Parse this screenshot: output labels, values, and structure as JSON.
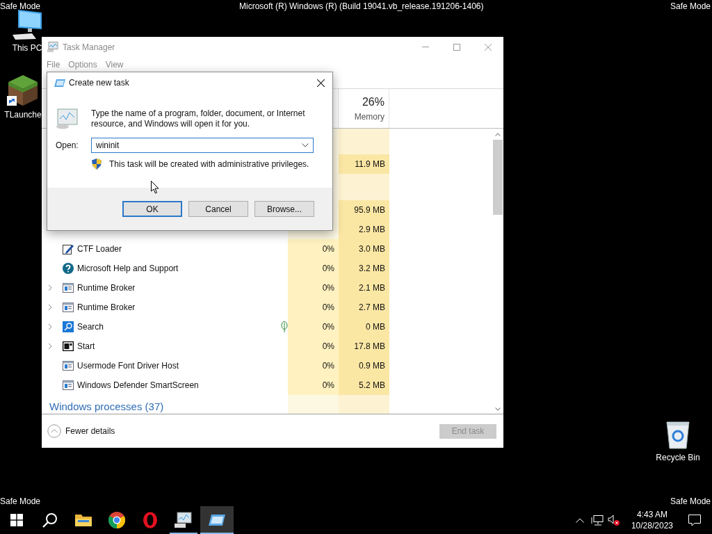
{
  "desktop": {
    "top_left": "Safe Mode",
    "top_center": "Microsoft (R) Windows (R) (Build 19041.vb_release.191206-1406)",
    "top_right": "Safe Mode",
    "bottom_left": "Safe Mode",
    "bottom_right": "Safe Mode",
    "icons": [
      {
        "kind": "computer",
        "label": "This PC"
      },
      {
        "kind": "block",
        "label": "TLaunche"
      },
      {
        "kind": "bin",
        "label": "Recycle Bin"
      }
    ]
  },
  "task_manager": {
    "title": "Task Manager",
    "menu": [
      "File",
      "Options",
      "View"
    ],
    "memory_header": {
      "value": "26%",
      "label": "Memory"
    },
    "rows": [
      {
        "kind": "spacer"
      },
      {
        "kind": "covered",
        "memory": "11.9 MB"
      },
      {
        "kind": "spacer"
      },
      {
        "kind": "covered",
        "memory": "95.9 MB"
      },
      {
        "kind": "covered",
        "memory": "2.9 MB"
      },
      {
        "kind": "pen",
        "name": "CTF Loader",
        "cpu": "0%",
        "memory": "3.0 MB",
        "expandable": false,
        "eco": false
      },
      {
        "kind": "help",
        "name": "Microsoft Help and Support",
        "cpu": "0%",
        "memory": "3.2 MB",
        "expandable": false,
        "eco": false
      },
      {
        "kind": "window",
        "name": "Runtime Broker",
        "cpu": "0%",
        "memory": "2.1 MB",
        "expandable": true,
        "eco": false
      },
      {
        "kind": "window",
        "name": "Runtime Broker",
        "cpu": "0%",
        "memory": "2.7 MB",
        "expandable": true,
        "eco": false
      },
      {
        "kind": "search",
        "name": "Search",
        "cpu": "0%",
        "memory": "0 MB",
        "expandable": true,
        "eco": true
      },
      {
        "kind": "start",
        "name": "Start",
        "cpu": "0%",
        "memory": "17.8 MB",
        "expandable": true,
        "eco": false
      },
      {
        "kind": "window",
        "name": "Usermode Font Driver Host",
        "cpu": "0%",
        "memory": "0.9 MB",
        "expandable": false,
        "eco": false
      },
      {
        "kind": "window",
        "name": "Windows Defender SmartScreen",
        "cpu": "0%",
        "memory": "5.2 MB",
        "expandable": false,
        "eco": false
      },
      {
        "kind": "heading",
        "name": "Windows processes (37)"
      }
    ],
    "fewer_details": "Fewer details",
    "end_task": {
      "label": "End task",
      "disabled": true
    }
  },
  "dialog": {
    "title": "Create new task",
    "message": "Type the name of a program, folder, document, or Internet resource, and Windows will open it for you.",
    "open_label": "Open:",
    "open_value": "wininit",
    "admin_note": "This task will be created with administrative privileges.",
    "buttons": [
      {
        "label": "OK",
        "default": true
      },
      {
        "label": "Cancel",
        "default": false
      },
      {
        "label": "Browse...",
        "default": false
      }
    ]
  },
  "taskbar": {
    "apps": [
      {
        "kind": "start",
        "running": false,
        "active": false
      },
      {
        "kind": "search",
        "running": false,
        "active": false
      },
      {
        "kind": "folder",
        "running": false,
        "active": false
      },
      {
        "kind": "chrome",
        "running": false,
        "active": false
      },
      {
        "kind": "opera",
        "running": false,
        "active": false
      },
      {
        "kind": "monitor",
        "running": true,
        "active": false
      },
      {
        "kind": "run",
        "running": true,
        "active": true
      }
    ],
    "time": "4:43 AM",
    "date": "10/28/2023"
  }
}
